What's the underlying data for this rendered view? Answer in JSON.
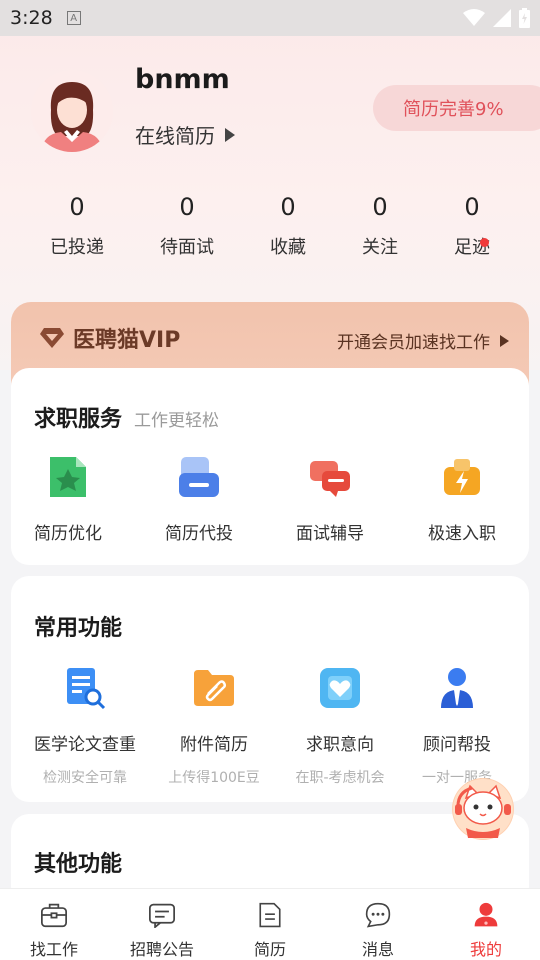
{
  "status_bar": {
    "time": "3:28",
    "a_icon": "A"
  },
  "profile": {
    "name": "bnmm",
    "online_resume": "在线简历",
    "completion": "简历完善9%"
  },
  "stats": [
    {
      "value": "0",
      "label": "已投递"
    },
    {
      "value": "0",
      "label": "待面试"
    },
    {
      "value": "0",
      "label": "收藏"
    },
    {
      "value": "0",
      "label": "关注"
    },
    {
      "value": "0",
      "label": "足迹",
      "has_dot": true
    }
  ],
  "vip": {
    "title": "医聘猫VIP",
    "link": "开通会员加速找工作"
  },
  "job_services": {
    "title": "求职服务",
    "subtitle": "工作更轻松",
    "items": [
      {
        "label": "简历优化",
        "icon": "resume-optimize-icon"
      },
      {
        "label": "简历代投",
        "icon": "resume-delivery-icon"
      },
      {
        "label": "面试辅导",
        "icon": "interview-coaching-icon"
      },
      {
        "label": "极速入职",
        "icon": "fast-onboard-icon"
      }
    ]
  },
  "common_functions": {
    "title": "常用功能",
    "items": [
      {
        "label": "医学论文查重",
        "desc": "检测安全可靠",
        "icon": "paper-check-icon"
      },
      {
        "label": "附件简历",
        "desc": "上传得100E豆",
        "icon": "attachment-resume-icon"
      },
      {
        "label": "求职意向",
        "desc": "在职-考虑机会",
        "icon": "job-intention-icon"
      },
      {
        "label": "顾问帮投",
        "desc": "一对一服务",
        "icon": "advisor-icon"
      }
    ]
  },
  "other_functions": {
    "title": "其他功能"
  },
  "bottom_nav": [
    {
      "label": "找工作",
      "icon": "briefcase-icon"
    },
    {
      "label": "招聘公告",
      "icon": "announcement-icon"
    },
    {
      "label": "简历",
      "icon": "resume-icon"
    },
    {
      "label": "消息",
      "icon": "message-icon"
    },
    {
      "label": "我的",
      "icon": "profile-icon",
      "active": true
    }
  ],
  "colors": {
    "accent": "#ee3b3b",
    "vip_bg": "#f3c6b1",
    "badge_bg": "#f7d7d7"
  }
}
